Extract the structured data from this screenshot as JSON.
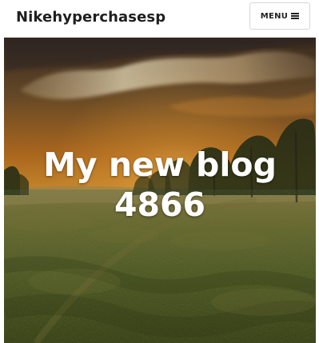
{
  "header": {
    "site_title": "Nikehyperchasesp",
    "menu_label": "MENU",
    "menu_icon": "hamburger-icon"
  },
  "hero": {
    "title": "My new blog\n4866",
    "image": "sunset-meadow-with-trees"
  },
  "colors": {
    "header_background": "#ffffff",
    "title_text": "#1f1f1f",
    "hero_text": "#ffffff",
    "sky_orange": "#c9781f",
    "grass_green": "#5f6b25"
  }
}
